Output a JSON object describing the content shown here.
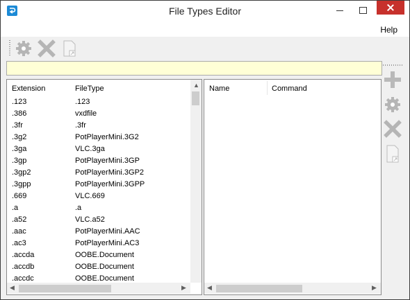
{
  "window": {
    "title": "File Types Editor"
  },
  "menu": {
    "help": "Help"
  },
  "toolbar": {
    "icons": [
      "gear-icon",
      "delete-x-icon",
      "document-shortcut-icon"
    ]
  },
  "search": {
    "value": ""
  },
  "left_table": {
    "columns": [
      "Extension",
      "FileType"
    ],
    "rows": [
      [
        ".123",
        ".123"
      ],
      [
        ".386",
        "vxdfile"
      ],
      [
        ".3fr",
        ".3fr"
      ],
      [
        ".3g2",
        "PotPlayerMini.3G2"
      ],
      [
        ".3ga",
        "VLC.3ga"
      ],
      [
        ".3gp",
        "PotPlayerMini.3GP"
      ],
      [
        ".3gp2",
        "PotPlayerMini.3GP2"
      ],
      [
        ".3gpp",
        "PotPlayerMini.3GPP"
      ],
      [
        ".669",
        "VLC.669"
      ],
      [
        ".a",
        ".a"
      ],
      [
        ".a52",
        "VLC.a52"
      ],
      [
        ".aac",
        "PotPlayerMini.AAC"
      ],
      [
        ".ac3",
        "PotPlayerMini.AC3"
      ],
      [
        ".accda",
        "OOBE.Document"
      ],
      [
        ".accdb",
        "OOBE.Document"
      ],
      [
        ".accdc",
        "OOBE.Document"
      ]
    ]
  },
  "right_table": {
    "columns": [
      "Name",
      "Command"
    ],
    "rows": []
  },
  "side_toolbar": {
    "icons": [
      "plus-icon",
      "gear-icon",
      "delete-x-icon",
      "document-shortcut-icon"
    ]
  },
  "colors": {
    "close_button": "#c7312c",
    "search_background": "#ffffd6",
    "icon_gray": "#b9b9b9"
  }
}
